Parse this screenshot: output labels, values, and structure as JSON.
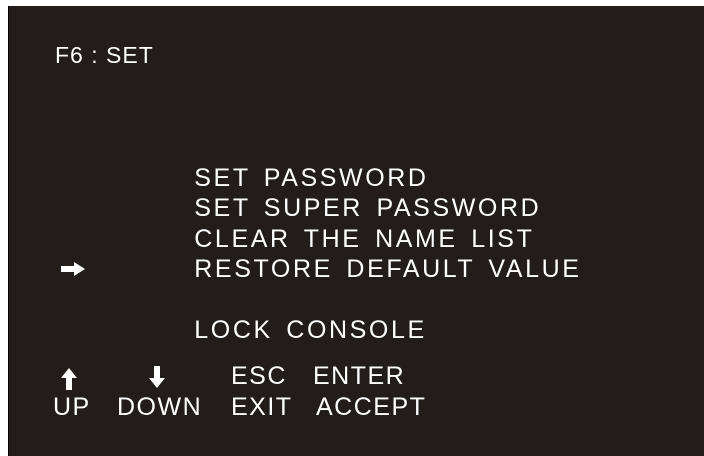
{
  "screen": {
    "title": "F6 : SET"
  },
  "menu": {
    "items": [
      {
        "label": "SET PASSWORD",
        "selected": false
      },
      {
        "label": "SET SUPER PASSWORD",
        "selected": false
      },
      {
        "label": "CLEAR THE NAME LIST",
        "selected": false
      },
      {
        "label": "RESTORE DEFAULT VALUE",
        "selected": false
      },
      {
        "label": "LOCK CONSOLE",
        "selected": true
      }
    ],
    "selector_icon": "right-arrow-icon"
  },
  "hints": {
    "up": {
      "icon": "up-arrow-icon",
      "label": "UP"
    },
    "down": {
      "icon": "down-arrow-icon",
      "label": "DOWN"
    },
    "esc": {
      "key": "ESC",
      "label": "EXIT"
    },
    "enter": {
      "key": "ENTER",
      "label": "ACCEPT"
    }
  },
  "colors": {
    "background": "#221d1b",
    "text": "#ffffff"
  }
}
